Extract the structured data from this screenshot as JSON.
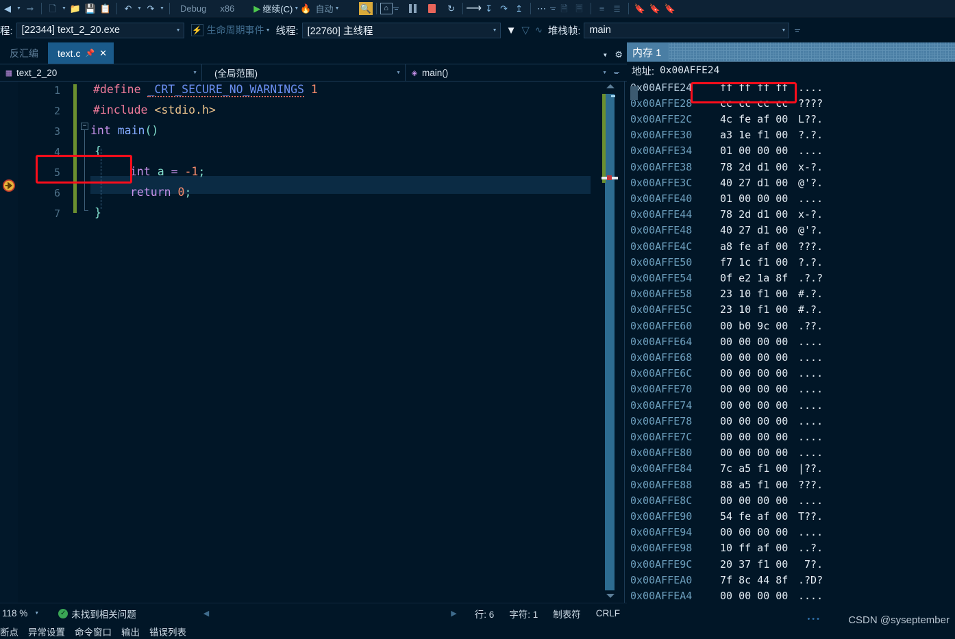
{
  "toolbar": {
    "config_label": "Debug",
    "platform_label": "x86",
    "continue_label": "继续(C)",
    "hot_reload_icon": "flame-icon",
    "auto_label": "自动",
    "icons": [
      "back-arrow-icon",
      "forward-arrow-icon",
      "new-file-icon",
      "open-folder-icon",
      "save-icon",
      "save-all-icon",
      "undo-icon",
      "redo-icon",
      "run-icon",
      "search-icon",
      "home-icon",
      "pause-icon",
      "stop-icon",
      "restart-icon",
      "step-over-icon",
      "step-into-icon",
      "step-out-icon",
      "return-icon",
      "threads-icon",
      "comment-icon",
      "uncomment-icon",
      "outdent-icon",
      "indent-icon",
      "bookmark-icon",
      "bookmark-next-icon",
      "bookmark-prev-icon"
    ]
  },
  "procbar": {
    "process_label": "程:",
    "process_value": "[22344] text_2_20.exe",
    "lifecycle_label": "生命周期事件",
    "thread_label": "线程:",
    "thread_value": "[22760] 主线程",
    "stackframe_label": "堆栈帧:",
    "stackframe_value": "main"
  },
  "editor": {
    "tab_inactive": "反汇编",
    "tab_active": "text.c",
    "nav_project": "text_2_20",
    "nav_scope": "(全局范围)",
    "nav_function": "main()",
    "lines": [
      {
        "n": "1",
        "code": "#define _CRT_SECURE_NO_WARNINGS 1"
      },
      {
        "n": "2",
        "code": "#include <stdio.h>"
      },
      {
        "n": "3",
        "code": "int main()"
      },
      {
        "n": "4",
        "code": "{"
      },
      {
        "n": "5",
        "code": "    int a = -1;"
      },
      {
        "n": "6",
        "code": "    return 0;"
      },
      {
        "n": "7",
        "code": "}"
      }
    ],
    "current_line": "6",
    "highlight_box_line": "5"
  },
  "memory": {
    "title": "内存 1",
    "address_label": "地址:",
    "address_value": "0x00AFFE24",
    "rows": [
      {
        "addr": "0x00AFFE24",
        "hex": "ff ff ff ff",
        "ascii": "...."
      },
      {
        "addr": "0x00AFFE28",
        "hex": "cc cc cc cc",
        "ascii": "????"
      },
      {
        "addr": "0x00AFFE2C",
        "hex": "4c fe af 00",
        "ascii": "L??."
      },
      {
        "addr": "0x00AFFE30",
        "hex": "a3 1e f1 00",
        "ascii": "?.?."
      },
      {
        "addr": "0x00AFFE34",
        "hex": "01 00 00 00",
        "ascii": "...."
      },
      {
        "addr": "0x00AFFE38",
        "hex": "78 2d d1 00",
        "ascii": "x-?."
      },
      {
        "addr": "0x00AFFE3C",
        "hex": "40 27 d1 00",
        "ascii": "@'?."
      },
      {
        "addr": "0x00AFFE40",
        "hex": "01 00 00 00",
        "ascii": "...."
      },
      {
        "addr": "0x00AFFE44",
        "hex": "78 2d d1 00",
        "ascii": "x-?."
      },
      {
        "addr": "0x00AFFE48",
        "hex": "40 27 d1 00",
        "ascii": "@'?."
      },
      {
        "addr": "0x00AFFE4C",
        "hex": "a8 fe af 00",
        "ascii": "???."
      },
      {
        "addr": "0x00AFFE50",
        "hex": "f7 1c f1 00",
        "ascii": "?.?."
      },
      {
        "addr": "0x00AFFE54",
        "hex": "0f e2 1a 8f",
        "ascii": ".?.?"
      },
      {
        "addr": "0x00AFFE58",
        "hex": "23 10 f1 00",
        "ascii": "#.?."
      },
      {
        "addr": "0x00AFFE5C",
        "hex": "23 10 f1 00",
        "ascii": "#.?."
      },
      {
        "addr": "0x00AFFE60",
        "hex": "00 b0 9c 00",
        "ascii": ".??."
      },
      {
        "addr": "0x00AFFE64",
        "hex": "00 00 00 00",
        "ascii": "...."
      },
      {
        "addr": "0x00AFFE68",
        "hex": "00 00 00 00",
        "ascii": "...."
      },
      {
        "addr": "0x00AFFE6C",
        "hex": "00 00 00 00",
        "ascii": "...."
      },
      {
        "addr": "0x00AFFE70",
        "hex": "00 00 00 00",
        "ascii": "...."
      },
      {
        "addr": "0x00AFFE74",
        "hex": "00 00 00 00",
        "ascii": "...."
      },
      {
        "addr": "0x00AFFE78",
        "hex": "00 00 00 00",
        "ascii": "...."
      },
      {
        "addr": "0x00AFFE7C",
        "hex": "00 00 00 00",
        "ascii": "...."
      },
      {
        "addr": "0x00AFFE80",
        "hex": "00 00 00 00",
        "ascii": "...."
      },
      {
        "addr": "0x00AFFE84",
        "hex": "7c a5 f1 00",
        "ascii": "|??."
      },
      {
        "addr": "0x00AFFE88",
        "hex": "88 a5 f1 00",
        "ascii": "???."
      },
      {
        "addr": "0x00AFFE8C",
        "hex": "00 00 00 00",
        "ascii": "...."
      },
      {
        "addr": "0x00AFFE90",
        "hex": "54 fe af 00",
        "ascii": "T??."
      },
      {
        "addr": "0x00AFFE94",
        "hex": "00 00 00 00",
        "ascii": "...."
      },
      {
        "addr": "0x00AFFE98",
        "hex": "10 ff af 00",
        "ascii": "..?."
      },
      {
        "addr": "0x00AFFE9C",
        "hex": "20 37 f1 00",
        "ascii": " 7?."
      },
      {
        "addr": "0x00AFFEA0",
        "hex": "7f 8c 44 8f",
        "ascii": ".?D?"
      },
      {
        "addr": "0x00AFFEA4",
        "hex": "00 00 00 00",
        "ascii": "...."
      }
    ]
  },
  "status": {
    "zoom": "118 %",
    "problems": "未找到相关问题",
    "line": "行: 6",
    "column": "字符: 1",
    "tabs_mode": "制表符",
    "eol": "CRLF"
  },
  "bottom_tabs": [
    "断点",
    "异常设置",
    "命令窗口",
    "输出",
    "错误列表"
  ],
  "watermark": "CSDN @syseptember",
  "colors": {
    "background": "#011627",
    "accent_blue": "#1a5a8a",
    "memory_header": "#4a7ea4",
    "highlight_red": "#fc0d1b",
    "keyword": "#c792ea",
    "preprocessor": "#f07b9a",
    "number": "#f78c6c",
    "string": "#ecc48d",
    "variable": "#7fdbca"
  }
}
